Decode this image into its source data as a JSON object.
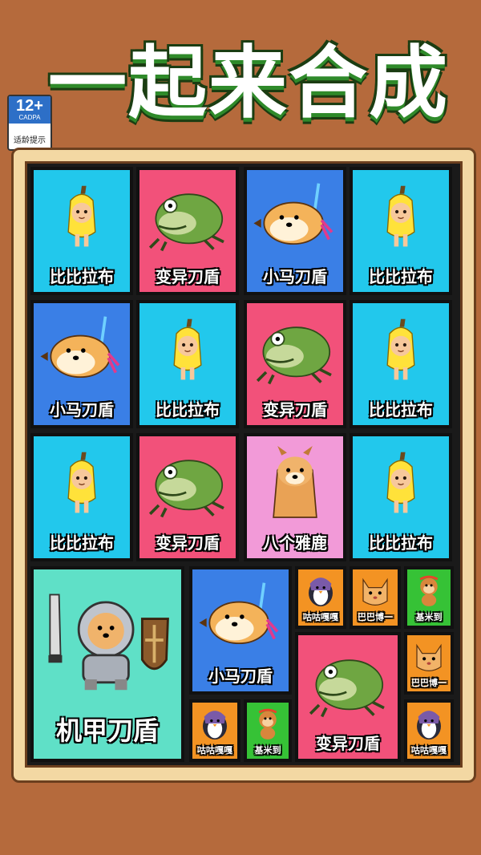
{
  "title": "一起来合成",
  "age_rating": {
    "number": "12+",
    "org": "CADPA",
    "tip": "适龄提示"
  },
  "grid": {
    "row1": [
      "比比拉布",
      "变异刀盾",
      "小马刀盾",
      "比比拉布"
    ],
    "row2": [
      "小马刀盾",
      "比比拉布",
      "变异刀盾",
      "比比拉布"
    ],
    "row3": [
      "比比拉布",
      "变异刀盾",
      "八个雅鹿",
      "比比拉布"
    ],
    "big": "机甲刀盾",
    "mid_top": "小马刀盾",
    "mid_bottom": "变异刀盾",
    "small": [
      "咕咕嘎嘎",
      "巴巴博一",
      "基米到",
      "巴巴博一",
      "咕咕嘎嘎",
      "基米到",
      "咕咕嘎嘎"
    ]
  },
  "icons": {
    "banana_cat": "banana-cat-icon",
    "frog": "frog-icon",
    "dog_sword": "dog-sword-icon",
    "cheems": "cheems-icon",
    "mech": "mech-dog-icon",
    "penguin": "penguin-icon",
    "cat": "cat-icon",
    "monkey": "monkey-icon"
  },
  "colors": {
    "cyan": "#22c8ec",
    "pink": "#f2517a",
    "blue": "#3a7fe6",
    "violet": "#f29ad8",
    "mint": "#5fe0c7",
    "orange": "#f39323",
    "green": "#36c236",
    "board": "#f3d8a3",
    "background": "#b56a3c"
  }
}
